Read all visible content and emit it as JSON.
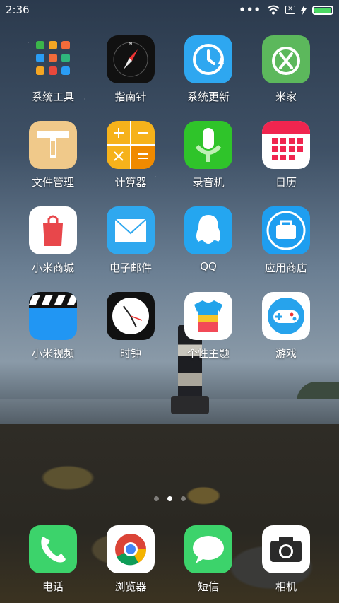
{
  "status_bar": {
    "time": "2:36",
    "more": "•••",
    "sim": "✕"
  },
  "apps": [
    {
      "name": "tools",
      "label": "系统工具"
    },
    {
      "name": "compass",
      "label": "指南针"
    },
    {
      "name": "update",
      "label": "系统更新"
    },
    {
      "name": "mijia",
      "label": "米家"
    },
    {
      "name": "files",
      "label": "文件管理"
    },
    {
      "name": "calculator",
      "label": "计算器"
    },
    {
      "name": "recorder",
      "label": "录音机"
    },
    {
      "name": "calendar",
      "label": "日历"
    },
    {
      "name": "mistore",
      "label": "小米商城"
    },
    {
      "name": "email",
      "label": "电子邮件"
    },
    {
      "name": "qq",
      "label": "QQ"
    },
    {
      "name": "appstore",
      "label": "应用商店"
    },
    {
      "name": "video",
      "label": "小米视频"
    },
    {
      "name": "clock",
      "label": "时钟"
    },
    {
      "name": "themes",
      "label": "个性主题"
    },
    {
      "name": "games",
      "label": "游戏"
    }
  ],
  "pager": {
    "pages": 3,
    "active": 2
  },
  "dock": [
    {
      "name": "phone",
      "label": "电话"
    },
    {
      "name": "browser",
      "label": "浏览器"
    },
    {
      "name": "messages",
      "label": "短信"
    },
    {
      "name": "camera",
      "label": "相机"
    }
  ],
  "colors": {
    "calculator": "#f6b21b",
    "recorder": "#35c82c",
    "mijia": "#5cb85c",
    "update": "#2ea7f0",
    "phone": "#3cd36b"
  }
}
